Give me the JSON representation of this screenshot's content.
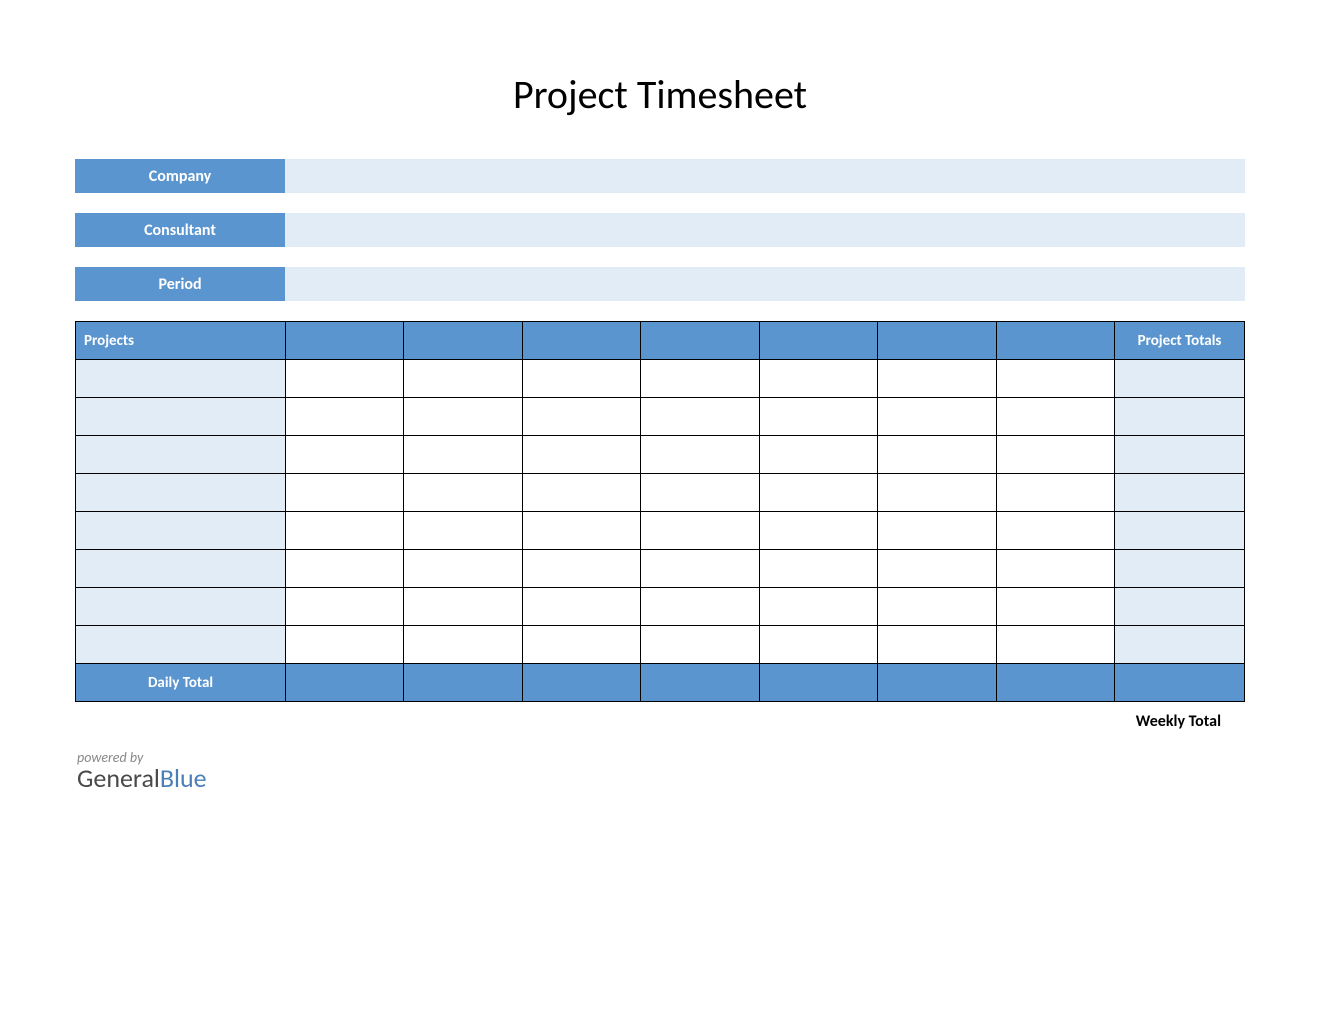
{
  "title": "Project Timesheet",
  "info": {
    "company_label": "Company",
    "company_value": "",
    "consultant_label": "Consultant",
    "consultant_value": "",
    "period_label": "Period",
    "period_value": ""
  },
  "table": {
    "header_projects": "Projects",
    "header_totals": "Project Totals",
    "day_headers": [
      "",
      "",
      "",
      "",
      "",
      "",
      ""
    ],
    "rows": [
      {
        "project": "",
        "days": [
          "",
          "",
          "",
          "",
          "",
          "",
          ""
        ],
        "total": ""
      },
      {
        "project": "",
        "days": [
          "",
          "",
          "",
          "",
          "",
          "",
          ""
        ],
        "total": ""
      },
      {
        "project": "",
        "days": [
          "",
          "",
          "",
          "",
          "",
          "",
          ""
        ],
        "total": ""
      },
      {
        "project": "",
        "days": [
          "",
          "",
          "",
          "",
          "",
          "",
          ""
        ],
        "total": ""
      },
      {
        "project": "",
        "days": [
          "",
          "",
          "",
          "",
          "",
          "",
          ""
        ],
        "total": ""
      },
      {
        "project": "",
        "days": [
          "",
          "",
          "",
          "",
          "",
          "",
          ""
        ],
        "total": ""
      },
      {
        "project": "",
        "days": [
          "",
          "",
          "",
          "",
          "",
          "",
          ""
        ],
        "total": ""
      },
      {
        "project": "",
        "days": [
          "",
          "",
          "",
          "",
          "",
          "",
          ""
        ],
        "total": ""
      }
    ],
    "daily_total_label": "Daily Total",
    "daily_totals": [
      "",
      "",
      "",
      "",
      "",
      "",
      ""
    ],
    "grand_total": ""
  },
  "weekly_total_label": "Weekly Total",
  "footer": {
    "powered_by": "powered by",
    "brand_general": "General",
    "brand_blue": "Blue"
  }
}
